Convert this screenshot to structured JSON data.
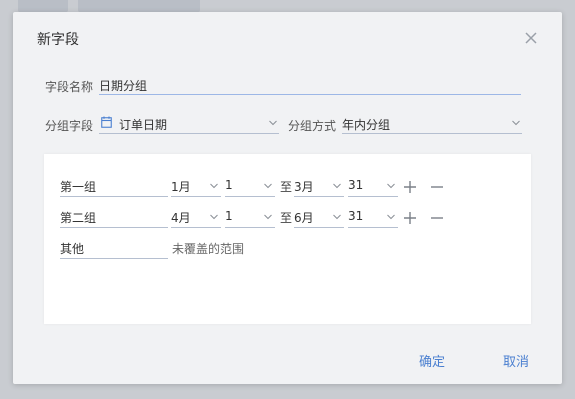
{
  "dialog": {
    "title": "新字段",
    "field_name_label": "字段名称",
    "field_name_value": "日期分组",
    "group_field_label": "分组字段",
    "group_field_value": "订单日期",
    "group_method_label": "分组方式",
    "group_method_value": "年内分组",
    "separator": "至",
    "groups": [
      {
        "name": "第一组",
        "start_month": "1月",
        "start_day": "1",
        "end_month": "3月",
        "end_day": "31"
      },
      {
        "name": "第二组",
        "start_month": "4月",
        "start_day": "1",
        "end_month": "6月",
        "end_day": "31"
      }
    ],
    "other": {
      "name": "其他",
      "note": "未覆盖的范围"
    },
    "confirm_label": "确定",
    "cancel_label": "取消"
  },
  "colors": {
    "accent": "#4a7fd0",
    "underline": "#b5bfd0",
    "panel": "#ffffff",
    "dialog_bg": "#f1f2f4"
  },
  "icons": {
    "close": "close-icon",
    "calendar": "calendar-icon",
    "chevron": "chevron-down-icon",
    "add": "plus-icon",
    "remove": "minus-icon"
  }
}
